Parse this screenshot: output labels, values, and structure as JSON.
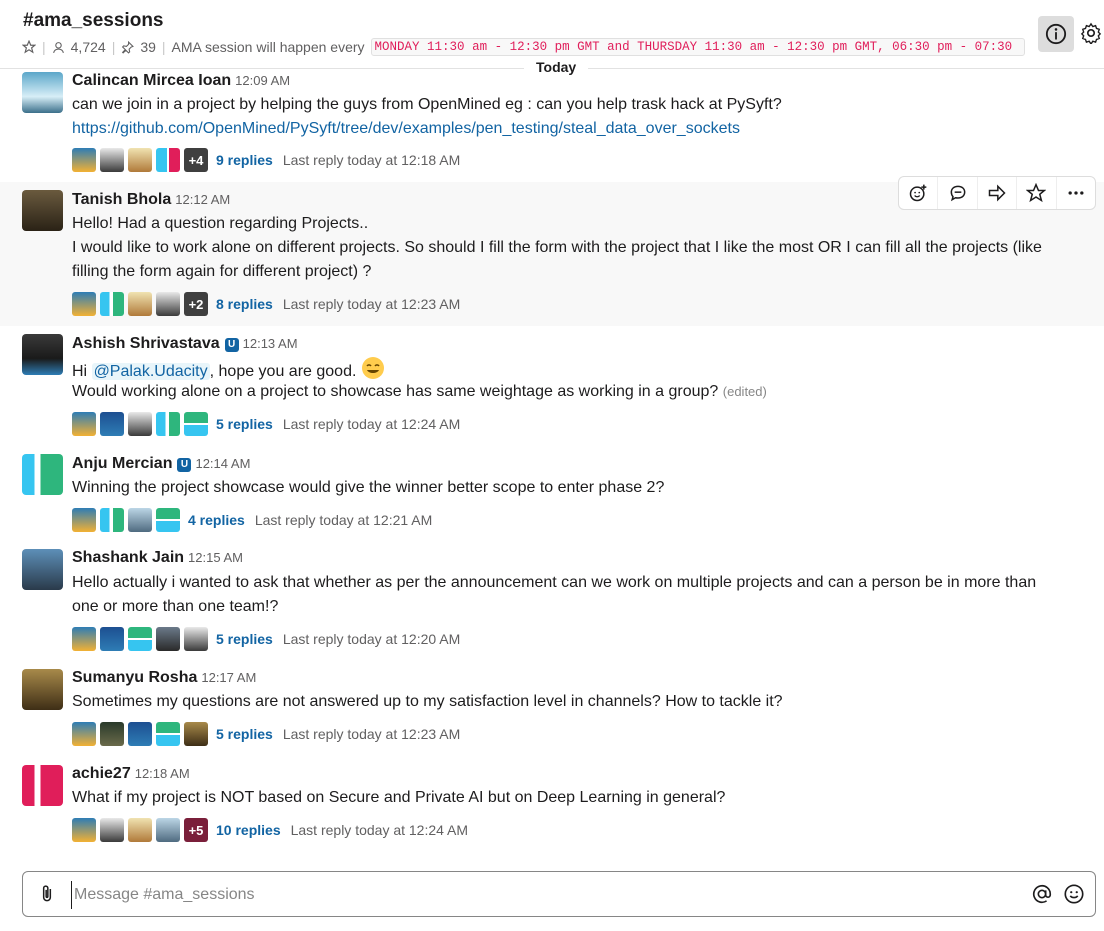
{
  "channel": {
    "name": "#ama_sessions",
    "members": "4,724",
    "pinned": "39",
    "topic_prefix": "AMA session will happen every",
    "topic_code": "MONDAY 11:30 am - 12:30 pm GMT and THURSDAY 11:30 am - 12:30 pm GMT, 06:30 pm - 07:30"
  },
  "divider": {
    "label": "Today"
  },
  "messages": [
    {
      "author": "Calincan Mircea Ioan",
      "time": "12:09 AM",
      "lines": [
        "can we join in a project by helping the guys from OpenMined eg : can you help trask  hack at PySyft?",
        "https://github.com/OpenMined/PySyft/tree/dev/examples/pen_testing/steal_data_over_sockets"
      ],
      "more_count": "+4",
      "replies": "9 replies",
      "last_reply": "Last reply today at 12:18 AM"
    },
    {
      "author": "Tanish Bhola",
      "time": "12:12 AM",
      "lines": [
        "Hello! Had a question regarding Projects..",
        "I would like to work alone on different projects. So should I fill the form with the project that I like the most OR I can fill all the projects (like",
        "filling the form again for different project) ?"
      ],
      "more_count": "+2",
      "replies": "8 replies",
      "last_reply": "Last reply today at 12:23 AM"
    },
    {
      "author": "Ashish Shrivastava",
      "time": "12:13 AM",
      "lines": [
        "Hi",
        "@Palak.Udacity",
        ", hope you are good.",
        "Would working alone on a project to showcase has same weightage as working in a group?",
        "(edited)"
      ],
      "replies": "5 replies",
      "last_reply": "Last reply today at 12:24 AM"
    },
    {
      "author": "Anju Mercian",
      "time": "12:14 AM",
      "lines": [
        "Winning the project showcase would give the winner better scope to enter phase 2?"
      ],
      "replies": "4 replies",
      "last_reply": "Last reply today at 12:21 AM"
    },
    {
      "author": "Shashank Jain",
      "time": "12:15 AM",
      "lines": [
        "Hello actually i wanted to ask that whether as per the announcement can we work on multiple projects and can a person be in more than",
        "one or more than one team!?"
      ],
      "replies": "5 replies",
      "last_reply": "Last reply today at 12:20 AM"
    },
    {
      "author": "Sumanyu Rosha",
      "time": "12:17 AM",
      "lines": [
        "Sometimes my questions are not answered up to my satisfaction level in channels? How to tackle it?"
      ],
      "replies": "5 replies",
      "last_reply": "Last reply today at 12:23 AM"
    },
    {
      "author": "achie27",
      "time": "12:18 AM",
      "lines": [
        "What if my project is NOT based on Secure and Private AI but on Deep Learning in general?"
      ],
      "more_count": "+5",
      "replies": "10 replies",
      "last_reply": "Last reply today at 12:24 AM"
    }
  ],
  "composer": {
    "placeholder": "Message #ama_sessions"
  },
  "icons": {
    "star": "star-icon",
    "members": "person-icon",
    "pin": "pin-icon",
    "info": "info-icon",
    "settings": "gear-icon",
    "add_reaction": "add-reaction-icon",
    "reply": "thread-reply-icon",
    "share": "share-icon",
    "save": "star-icon",
    "more": "more-actions-icon",
    "attach": "paperclip-icon",
    "mention": "at-icon",
    "emoji": "emoji-icon"
  },
  "colors": {
    "link": "#1264a3",
    "topic_code": "#e01e5a",
    "accent_teal": "#36c5f0",
    "accent_green": "#2eb67d",
    "accent_red": "#e01e5a"
  }
}
